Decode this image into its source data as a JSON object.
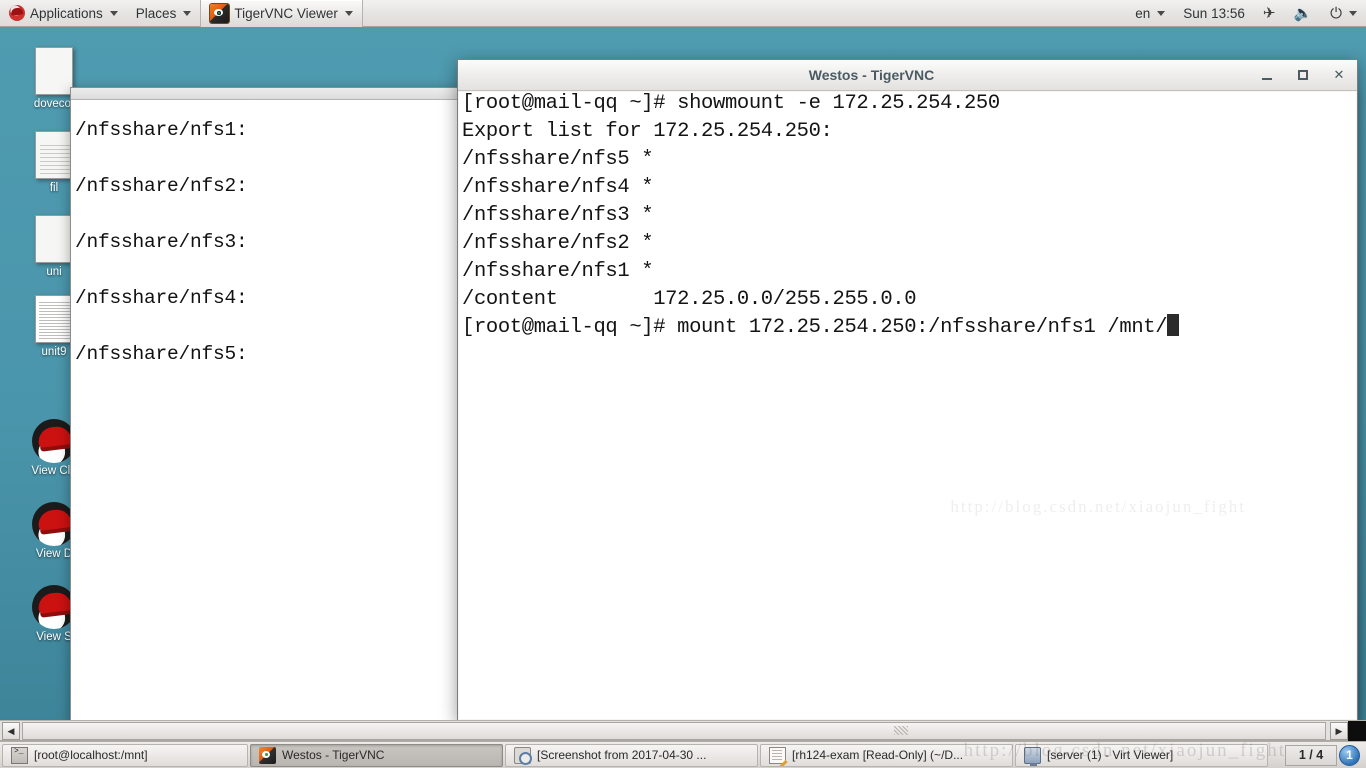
{
  "topbar": {
    "applications": "Applications",
    "places": "Places",
    "app_window": "TigerVNC Viewer",
    "keyboard": "en",
    "clock": "Sun 13:56",
    "icons": [
      "airplane-mode-icon",
      "volume-muted-icon",
      "power-icon"
    ]
  },
  "desktop": {
    "icons": [
      {
        "label": "dovecot",
        "type": "file"
      },
      {
        "label": "fil",
        "type": "text-file"
      },
      {
        "label": "uni",
        "type": "file"
      },
      {
        "label": "unit9",
        "type": "document"
      },
      {
        "label": "View Cla",
        "type": "redhat"
      },
      {
        "label": "View D",
        "type": "redhat"
      },
      {
        "label": "View S",
        "type": "redhat"
      }
    ]
  },
  "background_window": {
    "lines": [
      "/nfsshare/nfs1:",
      "/nfsshare/nfs2:",
      "/nfsshare/nfs3:",
      "/nfsshare/nfs4:",
      "/nfsshare/nfs5:"
    ]
  },
  "vnc_window": {
    "title": "Westos - TigerVNC",
    "buttons": {
      "minimize": "minimize-button",
      "maximize": "maximize-button",
      "close": "✕"
    },
    "terminal_lines": [
      "[root@mail-qq ~]# showmount -e 172.25.254.250",
      "Export list for 172.25.254.250:",
      "/nfsshare/nfs5 *",
      "/nfsshare/nfs4 *",
      "/nfsshare/nfs3 *",
      "/nfsshare/nfs2 *",
      "/nfsshare/nfs1 *",
      "/content        172.25.0.0/255.255.0.0"
    ],
    "prompt_line": "[root@mail-qq ~]# mount 172.25.254.250:/nfsshare/nfs1 /mnt/"
  },
  "taskbar": {
    "items": [
      {
        "label": "[root@localhost:/mnt]",
        "icon": "terminal-icon",
        "selected": false
      },
      {
        "label": "Westos - TigerVNC",
        "icon": "tigervnc-icon",
        "selected": true
      },
      {
        "label": "[Screenshot from 2017-04-30 ...",
        "icon": "screenshot-icon",
        "selected": false
      },
      {
        "label": "[rh124-exam [Read-Only] (~/D...",
        "icon": "document-icon",
        "selected": false
      },
      {
        "label": "[server (1) - Virt Viewer]",
        "icon": "virt-viewer-icon",
        "selected": false
      }
    ],
    "pager": "1 / 4",
    "tray_badge": "1"
  },
  "scrollbars": {
    "left_arrow": "◀",
    "right_arrow": "▶",
    "up_arrow": "▲",
    "down_arrow": "▼"
  },
  "watermark": "http://blog.csdn.net/xiaojun_fight"
}
